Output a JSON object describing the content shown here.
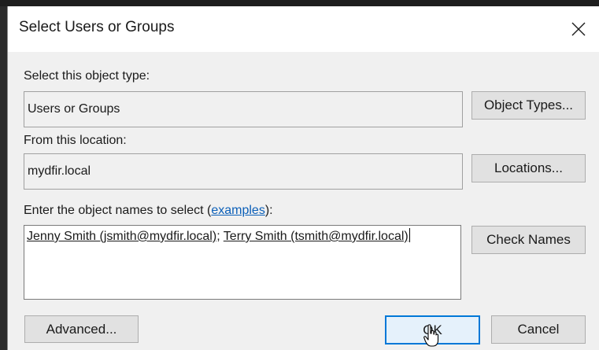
{
  "dialog": {
    "title": "Select Users or Groups"
  },
  "object_type": {
    "label": "Select this object type:",
    "value": "Users or Groups",
    "button": "Object Types..."
  },
  "location": {
    "label": "From this location:",
    "value": "mydfir.local",
    "button": "Locations..."
  },
  "names": {
    "label_prefix": "Enter the object names to select (",
    "link": "examples",
    "label_suffix": "):",
    "entry_1": "Jenny Smith (jsmith@mydfir.local)",
    "separator": "; ",
    "entry_2": "Terry Smith (tsmith@mydfir.local)",
    "check_button": "Check Names"
  },
  "footer": {
    "advanced": "Advanced...",
    "ok": "OK",
    "cancel": "Cancel"
  },
  "colors": {
    "accent": "#0078d7",
    "link": "#0b5fb8",
    "dialog_bg": "#f0f0f0"
  }
}
